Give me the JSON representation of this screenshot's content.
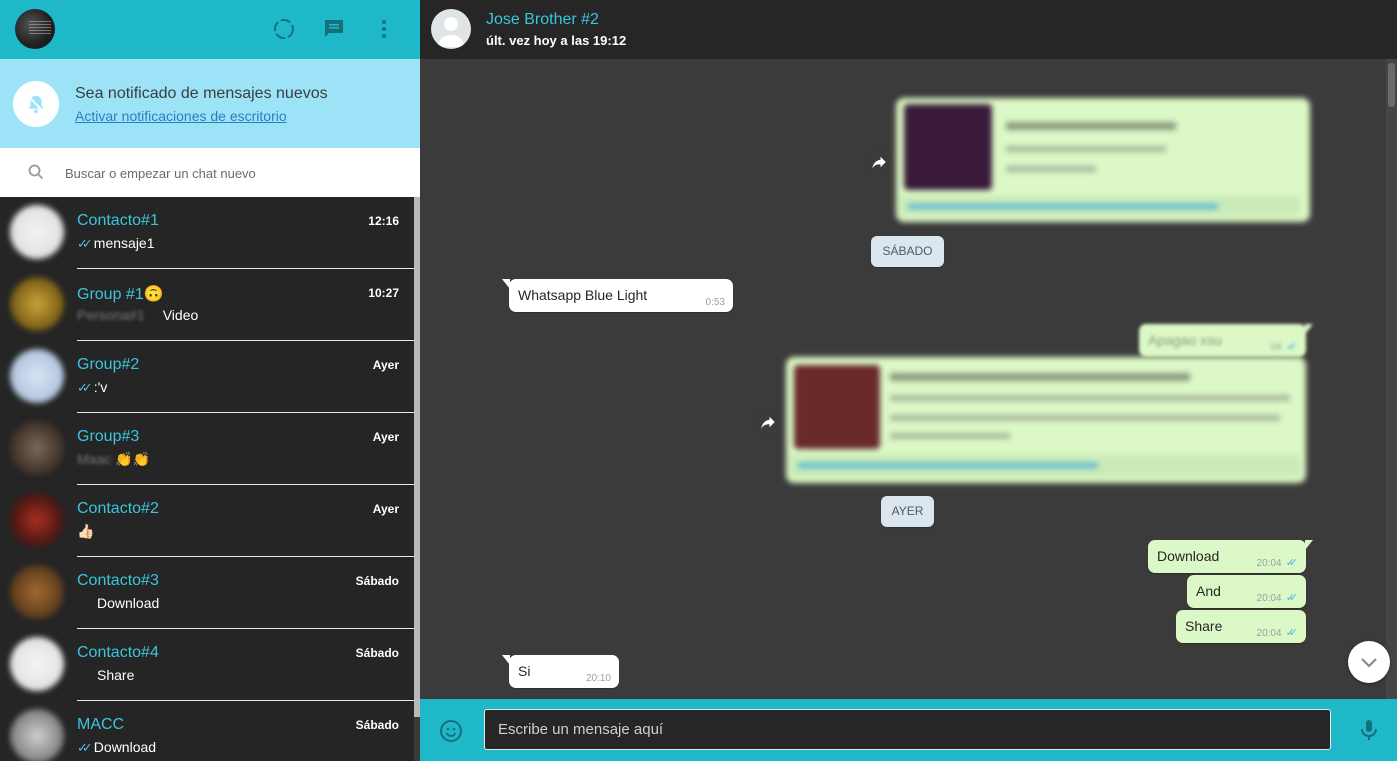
{
  "colors": {
    "accent": "#1fb8c9",
    "dark_bg": "#252525",
    "contact_name": "#39c6dc",
    "notif_bg": "#9de3f8",
    "out_bubble": "#dcf8c6"
  },
  "left_header": {
    "icons": [
      "status-icon",
      "new-chat-icon",
      "menu-icon"
    ]
  },
  "notification": {
    "title": "Sea notificado de mensajes nuevos",
    "link": "Activar notificaciones de escritorio"
  },
  "search": {
    "placeholder": "Buscar o empezar un chat nuevo"
  },
  "chats": [
    {
      "name": "Contacto#1",
      "time": "12:16",
      "ticks": "✓✓",
      "message": "mensaje1"
    },
    {
      "name": "Group #1",
      "emoji": "🙃",
      "time": "10:27",
      "sender": "Persona#1",
      "message": "Video"
    },
    {
      "name": "Group#2",
      "time": "Ayer",
      "ticks": "✓✓",
      "message": ":'v"
    },
    {
      "name": "Group#3",
      "time": "Ayer",
      "sender": "Maac",
      "message": "👏👏"
    },
    {
      "name": "Contacto#2",
      "time": "Ayer",
      "message": "👍🏻"
    },
    {
      "name": "Contacto#3",
      "time": "Sábado",
      "message": "Download"
    },
    {
      "name": "Contacto#4",
      "time": "Sábado",
      "message": "Share"
    },
    {
      "name": "MACC",
      "time": "Sábado",
      "ticks": "✓✓",
      "message": "Download"
    }
  ],
  "conversation": {
    "contact_name": "Jose Brother #2",
    "status": "últ. vez hoy a las 19:12",
    "date_chips": [
      "SÁBADO",
      "AYER"
    ],
    "messages": [
      {
        "direction": "in",
        "text": "Whatsapp Blue Light",
        "time": "0:53"
      },
      {
        "direction": "out",
        "text": "Apagao xsu",
        "time": "04"
      },
      {
        "direction": "out",
        "text": "Download",
        "time": "20:04"
      },
      {
        "direction": "out",
        "text": "And",
        "time": "20:04"
      },
      {
        "direction": "out",
        "text": "Share",
        "time": "20:04"
      },
      {
        "direction": "in",
        "text": "Si",
        "time": "20:10"
      }
    ],
    "ticks": "✓✓"
  },
  "composer": {
    "placeholder": "Escribe un mensaje aquí"
  }
}
